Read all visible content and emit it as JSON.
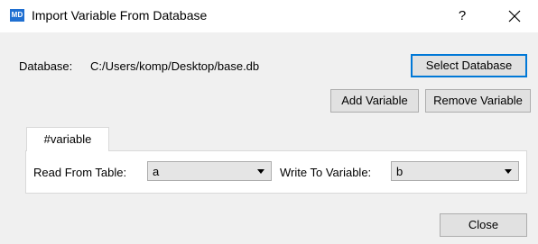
{
  "window": {
    "app_icon_text": "MD",
    "title": "Import Variable From Database",
    "help_glyph": "?"
  },
  "database": {
    "label": "Database:",
    "path": "C:/Users/komp/Desktop/base.db",
    "select_button": "Select Database"
  },
  "actions": {
    "add_variable": "Add Variable",
    "remove_variable": "Remove Variable"
  },
  "tabs": [
    {
      "label": "#variable",
      "selected": true
    }
  ],
  "mapping": {
    "read_label": "Read From Table:",
    "read_value": "a",
    "write_label": "Write To Variable:",
    "write_value": "b"
  },
  "footer": {
    "close_button": "Close"
  },
  "colors": {
    "accent": "#0078d7",
    "icon_bg": "#1f6fd1"
  }
}
